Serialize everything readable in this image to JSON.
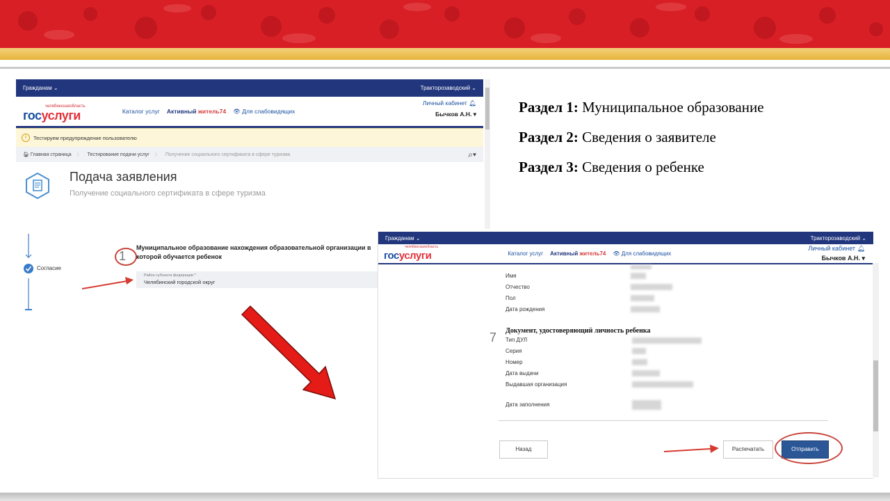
{
  "colors": {
    "banner_red": "#d81f26",
    "gold": "#e6b33b",
    "gosuslugi_blue": "#22367d",
    "accent_red": "#e2323c",
    "send_button": "#2b5797"
  },
  "shot1": {
    "topbar": {
      "left": "Гражданам",
      "right": "Тракторозаводский"
    },
    "logo": {
      "region": "челябинскаяобласть",
      "main_left": "гос",
      "main_right": "услуги"
    },
    "nav": {
      "catalog": "Каталог услуг",
      "active_left": "Активный",
      "active_right": "житель74",
      "accessibility": "Для слабовидящих"
    },
    "account": {
      "cabinet": "Личный кабинет",
      "user": "Бычков А.Н."
    },
    "warning": "Тестируем предупреждение пользователю",
    "breadcrumb": {
      "home": "Главная страница",
      "second": "Тестирование подачи услуг",
      "third": "Получение социального сертификата в сфере туризма"
    },
    "page_title": "Подача заявления",
    "page_subtitle": "Получение социального сертификата в сфере туризма",
    "step_label": "Согласие",
    "question_number": "1",
    "question_text": "Муниципальное образование нахождения образовательной организации в которой обучается ребенок",
    "field_label": "Район субъекта федерации *",
    "field_value": "Челябинский городской округ"
  },
  "sections": [
    {
      "prefix": "Раздел 1:",
      "text": "Муниципальное образование"
    },
    {
      "prefix": "Раздел 2:",
      "text": "Сведения о заявителе"
    },
    {
      "prefix": "Раздел 3:",
      "text": "Сведения о ребенке"
    }
  ],
  "shot2": {
    "topbar": {
      "left": "Гражданам",
      "right": "Тракторозаводский"
    },
    "logo": {
      "region": "челябинскаяобласть",
      "main_left": "гос",
      "main_right": "услуги"
    },
    "nav": {
      "catalog": "Каталог услуг",
      "active_left": "Активный",
      "active_right": "житель74",
      "accessibility": "Для слабовидящих"
    },
    "account": {
      "cabinet": "Личный кабинет",
      "user": "Бычков А.Н."
    },
    "child_fields": [
      "Имя",
      "Отчество",
      "Пол",
      "Дата рождения"
    ],
    "doc_section_number": "7",
    "doc_section_title": "Документ, удостоверяющий личность ребенка",
    "doc_fields": [
      "Тип ДУЛ",
      "Серия",
      "Номер",
      "Дата выдачи",
      "Выдавшая организация"
    ],
    "fill_date_label": "Дата заполнения",
    "buttons": {
      "back": "Назад",
      "print": "Распечатать",
      "send": "Отправить"
    }
  }
}
